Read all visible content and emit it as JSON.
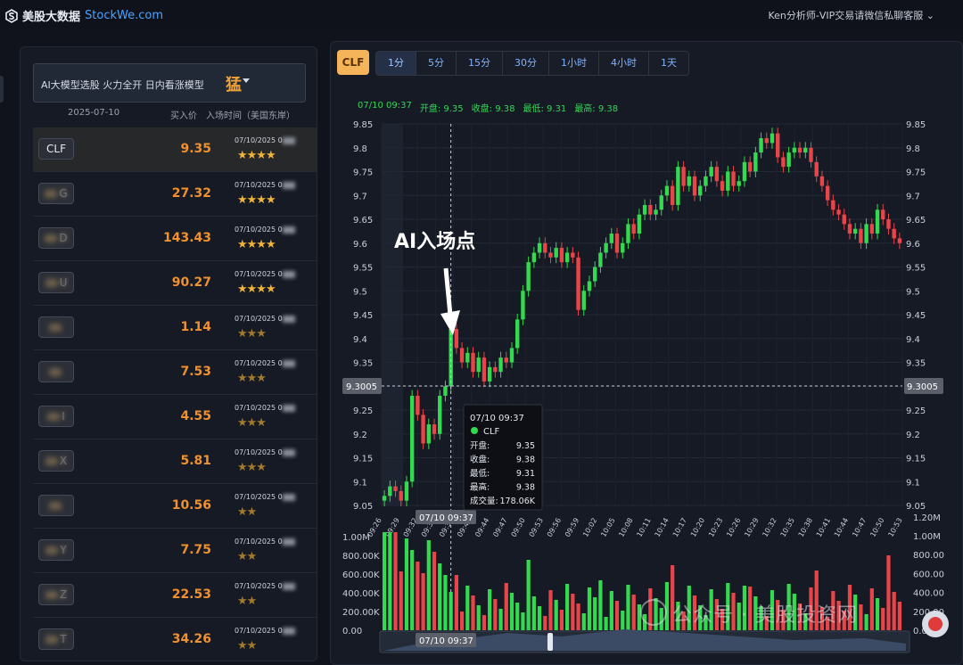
{
  "header": {
    "brand_cn": "美股大数据",
    "brand_en": "StockWe.com",
    "account": "Ken分析师-VIP交易请微信私聊客服"
  },
  "left": {
    "model_label": "AI大模型选股 火力全开 日内看涨模型",
    "model_badge": "猛",
    "col_date": "2025-07-10",
    "col_price": "买入价",
    "col_time": "入场时间（美国东岸）",
    "rows": [
      {
        "ticker": "CLF",
        "blur": false,
        "price": "9.35",
        "time": "07/10/2025 0",
        "stars": "★★★★",
        "dim": false
      },
      {
        "ticker": "G",
        "blur": true,
        "price": "27.32",
        "time": "07/10/2025 0",
        "stars": "★★★★",
        "dim": false
      },
      {
        "ticker": "D",
        "blur": true,
        "price": "143.43",
        "time": "07/10/2025 0",
        "stars": "★★★★",
        "dim": false
      },
      {
        "ticker": "U",
        "blur": true,
        "price": "90.27",
        "time": "07/10/2025 0",
        "stars": "★★★★",
        "dim": false
      },
      {
        "ticker": "",
        "blur": true,
        "price": "1.14",
        "time": "07/10/2025 0",
        "stars": "★★★",
        "dim": true
      },
      {
        "ticker": "",
        "blur": true,
        "price": "7.53",
        "time": "07/10/2025 0",
        "stars": "★★★",
        "dim": true
      },
      {
        "ticker": "I",
        "blur": true,
        "price": "4.55",
        "time": "07/10/2025 0",
        "stars": "★★★",
        "dim": true
      },
      {
        "ticker": "X",
        "blur": true,
        "price": "5.81",
        "time": "07/10/2025 0",
        "stars": "★★★",
        "dim": true
      },
      {
        "ticker": "",
        "blur": true,
        "price": "10.56",
        "time": "07/10/2025 0",
        "stars": "★★",
        "dim": true
      },
      {
        "ticker": "Y",
        "blur": true,
        "price": "7.75",
        "time": "07/10/2025 0",
        "stars": "★★",
        "dim": true
      },
      {
        "ticker": "Z",
        "blur": true,
        "price": "22.53",
        "time": "07/10/2025 0",
        "stars": "★★",
        "dim": true
      },
      {
        "ticker": "T",
        "blur": true,
        "price": "34.26",
        "time": "07/10/2025 0",
        "stars": "★★",
        "dim": true
      }
    ]
  },
  "chart": {
    "symbol": "CLF",
    "periods": [
      "1分",
      "5分",
      "15分",
      "30分",
      "1小时",
      "4小时",
      "1天"
    ],
    "selected_period": "1分",
    "ohlc_time": "07/10 09:37",
    "ohlc_open": "开盘: 9.35",
    "ohlc_close": "收盘: 9.38",
    "ohlc_low": "最低: 9.31",
    "ohlc_high": "最高: 9.38",
    "annotation": "AI入场点",
    "crosshair_price": "9.3005",
    "crosshair_time": "07/10 09:37",
    "tooltip": {
      "time": "07/10 09:37",
      "name": "CLF",
      "rows": [
        [
          "开盘:",
          "9.35"
        ],
        [
          "收盘:",
          "9.38"
        ],
        [
          "最低:",
          "9.31"
        ],
        [
          "最高:",
          "9.38"
        ],
        [
          "成交量:",
          "178.06K"
        ]
      ]
    },
    "watermark": "公众号 · 美股投资网",
    "colors": {
      "up": "#33d94f",
      "down": "#e8454b",
      "accent": "#f5b35a"
    }
  },
  "chart_data": {
    "type": "candlestick",
    "price_ticks": [
      "9.05",
      "9.1",
      "9.15",
      "9.2",
      "9.25",
      "9.3",
      "9.35",
      "9.4",
      "9.45",
      "9.5",
      "9.55",
      "9.6",
      "9.65",
      "9.7",
      "9.75",
      "9.8",
      "9.85"
    ],
    "ylim": [
      9.05,
      9.85
    ],
    "vol_ticks_left": [
      "0.00",
      "200.00K",
      "400.00K",
      "600.00K",
      "800.00K",
      "1.00M"
    ],
    "vol_ticks_right": [
      "0.00",
      "200.00",
      "400.00",
      "600.00",
      "800.00",
      "1.00M",
      "1.20M"
    ],
    "time_ticks": [
      "09:26",
      "09:29",
      "09:32",
      "09:35",
      "09:38",
      "09:41",
      "09:44",
      "09:47",
      "09:50",
      "09:53",
      "09:56",
      "09:59",
      "10:02",
      "10:05",
      "10:08",
      "10:11",
      "10:14",
      "10:17",
      "10:20",
      "10:23",
      "10:26",
      "10:29",
      "10:32",
      "10:35",
      "10:38",
      "10:41",
      "10:44",
      "10:47",
      "10:50",
      "10:53"
    ],
    "close": [
      9.07,
      9.09,
      9.08,
      9.06,
      9.1,
      9.28,
      9.24,
      9.18,
      9.22,
      9.2,
      9.28,
      9.3,
      9.42,
      9.38,
      9.35,
      9.37,
      9.33,
      9.36,
      9.31,
      9.34,
      9.33,
      9.36,
      9.35,
      9.38,
      9.44,
      9.5,
      9.56,
      9.58,
      9.6,
      9.58,
      9.57,
      9.59,
      9.56,
      9.58,
      9.57,
      9.46,
      9.5,
      9.52,
      9.55,
      9.58,
      9.6,
      9.62,
      9.58,
      9.6,
      9.64,
      9.62,
      9.66,
      9.68,
      9.66,
      9.67,
      9.7,
      9.72,
      9.68,
      9.76,
      9.72,
      9.74,
      9.7,
      9.72,
      9.74,
      9.76,
      9.73,
      9.71,
      9.75,
      9.72,
      9.73,
      9.77,
      9.75,
      9.79,
      9.82,
      9.81,
      9.83,
      9.78,
      9.76,
      9.79,
      9.8,
      9.79,
      9.8,
      9.77,
      9.74,
      9.72,
      9.69,
      9.67,
      9.66,
      9.64,
      9.62,
      9.63,
      9.6,
      9.64,
      9.62,
      9.67,
      9.65,
      9.63,
      9.61,
      9.6
    ]
  }
}
